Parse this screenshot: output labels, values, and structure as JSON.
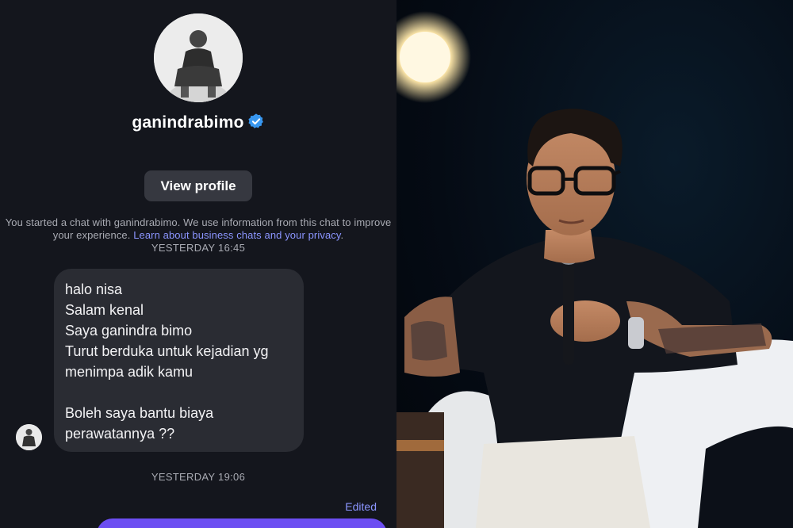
{
  "chat": {
    "username": "ganindrabimo",
    "view_profile_label": "View profile",
    "disclaimer_text": "You started a chat with ganindrabimo. We use information from this chat to improve your experience.",
    "disclaimer_link": "Learn about business chats and your privacy",
    "timestamp_1": "YESTERDAY 16:45",
    "message": "halo nisa\nSalam kenal\nSaya ganindra bimo\nTurut berduka untuk kejadian yg\nmenimpa adik kamu\n\nBoleh saya bantu biaya\nperawatannya ??",
    "timestamp_2": "YESTERDAY 19:06",
    "edited_label": "Edited"
  },
  "colors": {
    "background": "#14161d",
    "bubble": "#2a2c33",
    "accent": "#8b95ff",
    "sent_bubble": "#6c4ef2",
    "verified_badge": "#3897f0"
  },
  "icons": {
    "verified": "verified-badge-icon"
  }
}
